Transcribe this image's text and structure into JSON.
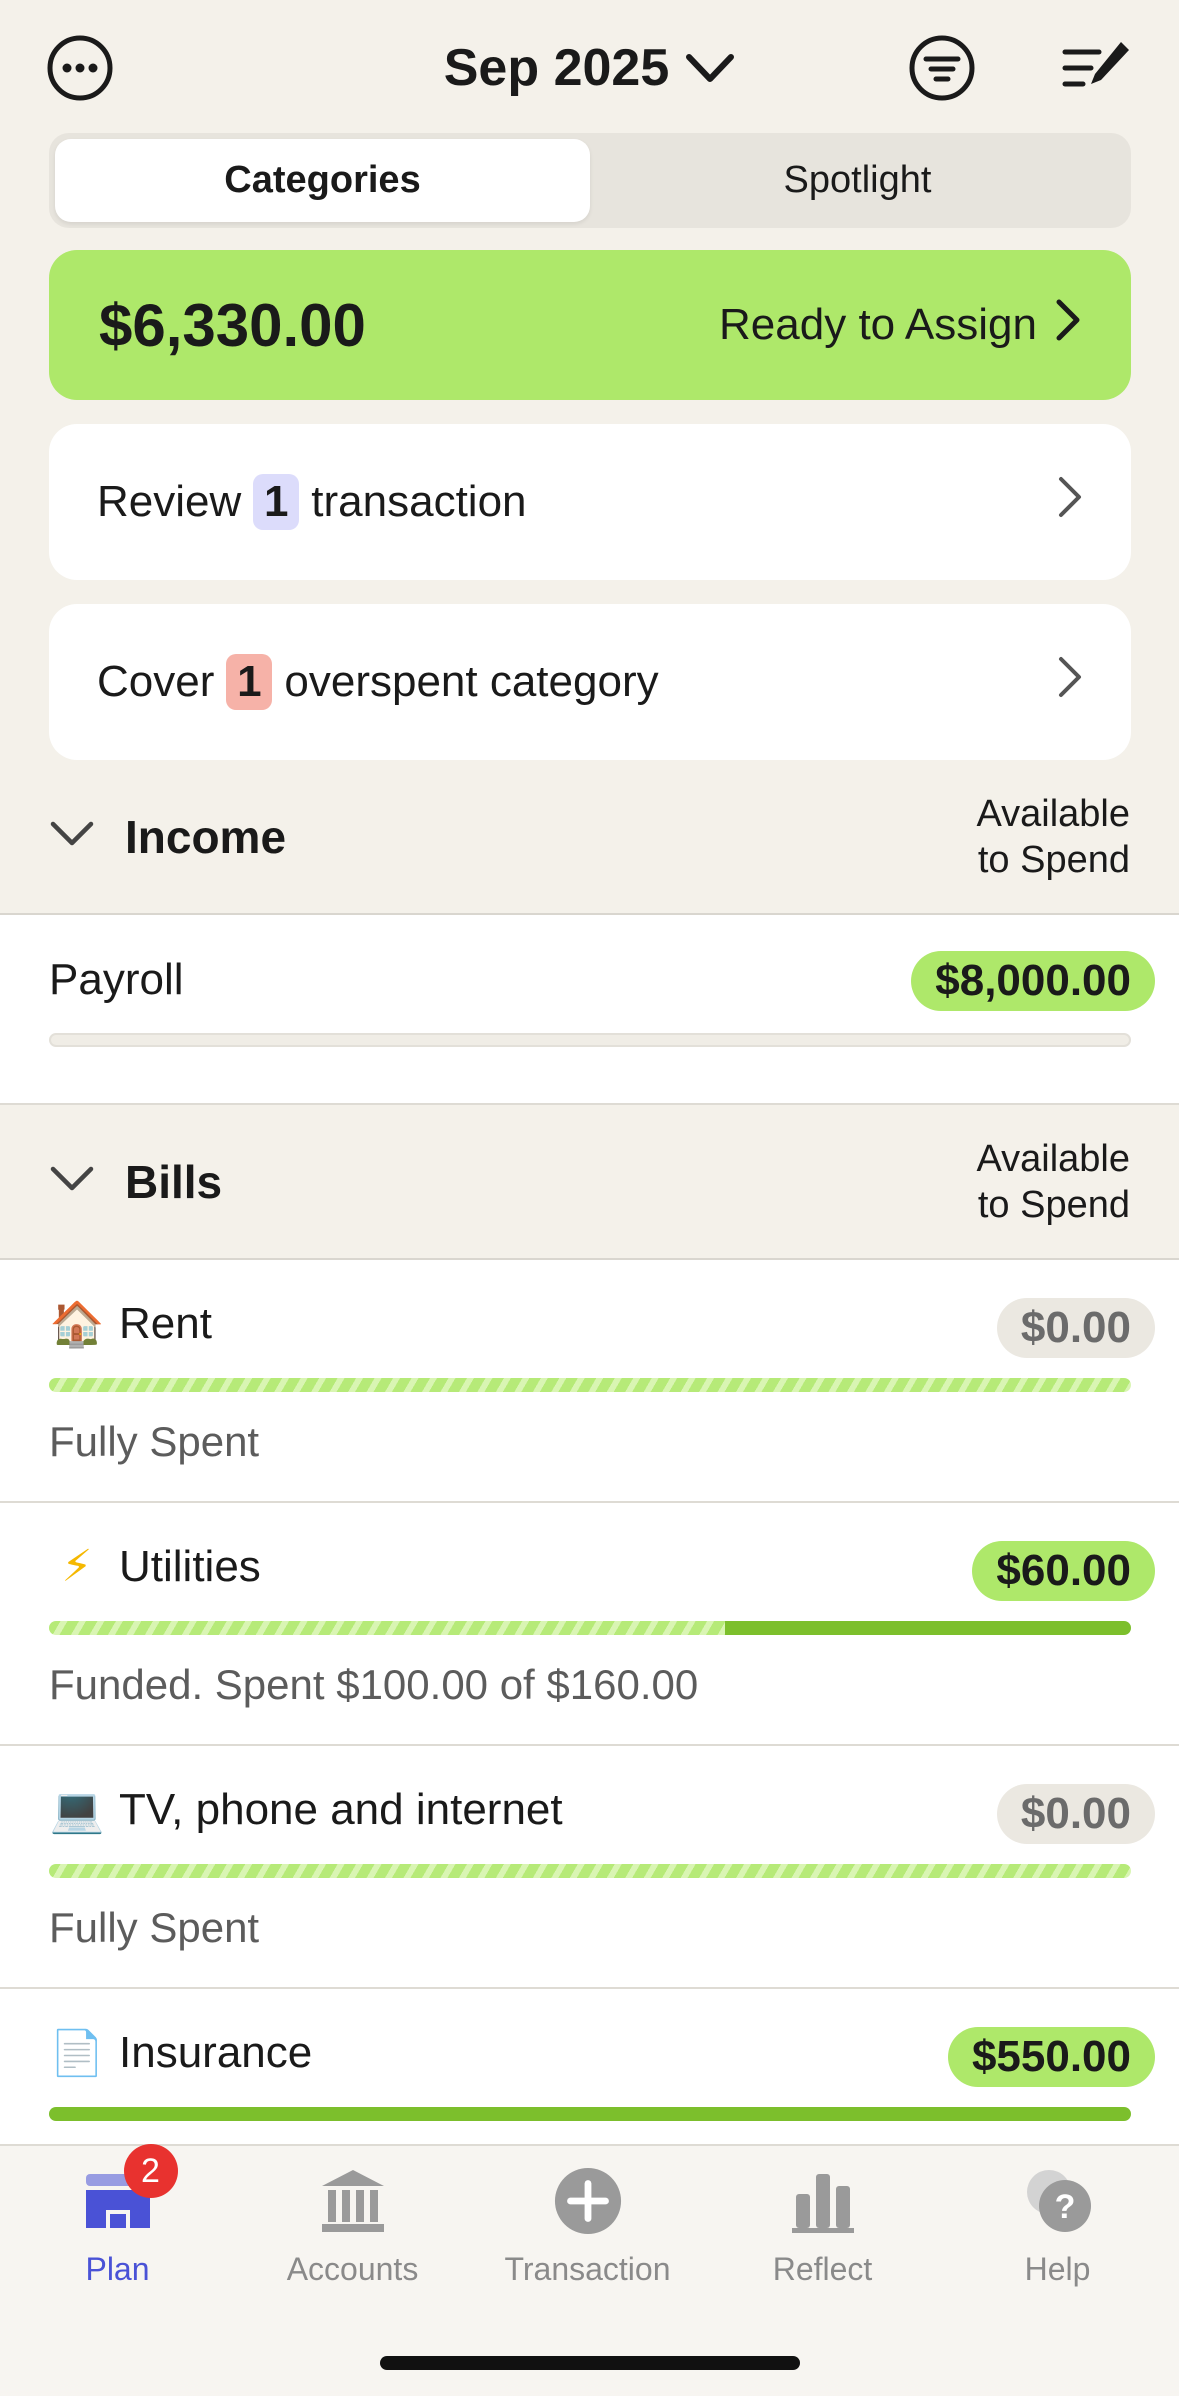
{
  "header": {
    "month_label": "Sep 2025"
  },
  "segments": {
    "categories": "Categories",
    "spotlight": "Spotlight"
  },
  "ready": {
    "amount": "$6,330.00",
    "label": "Ready to Assign"
  },
  "review": {
    "prefix": "Review",
    "count": "1",
    "suffix": "transaction"
  },
  "cover": {
    "prefix": "Cover",
    "count": "1",
    "suffix": "overspent category"
  },
  "income": {
    "title": "Income",
    "avail_line1": "Available",
    "avail_line2": "to Spend",
    "rows": [
      {
        "name": "Payroll",
        "amount": "$8,000.00"
      }
    ]
  },
  "bills": {
    "title": "Bills",
    "avail_line1": "Available",
    "avail_line2": "to Spend",
    "rows": [
      {
        "emoji": "🏠",
        "name": "Rent",
        "amount": "$0.00",
        "status": "Fully Spent"
      },
      {
        "emoji": "⚡",
        "name": "Utilities",
        "amount": "$60.00",
        "status": "Funded. Spent $100.00 of $160.00",
        "spent_fraction": 0.625
      },
      {
        "emoji": "💻",
        "name": "TV, phone and internet",
        "amount": "$0.00",
        "status": "Fully Spent"
      },
      {
        "emoji": "📄",
        "name": "Insurance",
        "amount": "$550.00"
      }
    ]
  },
  "tabs": [
    {
      "label": "Plan",
      "badge": "2"
    },
    {
      "label": "Accounts"
    },
    {
      "label": "Transaction"
    },
    {
      "label": "Reflect"
    },
    {
      "label": "Help"
    }
  ],
  "colors": {
    "accent_green": "#aee86a",
    "bar_green": "#7cbf2c",
    "active_tab": "#4a52d6",
    "review_badge": "#dcdcfb",
    "cover_badge": "#f6b2a8"
  }
}
